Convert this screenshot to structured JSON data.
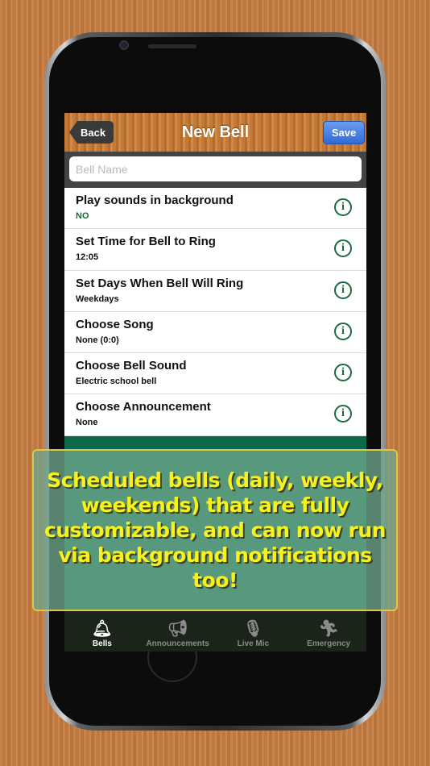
{
  "nav": {
    "back": "Back",
    "title": "New Bell",
    "save": "Save"
  },
  "bell_name": {
    "placeholder": "Bell Name",
    "value": ""
  },
  "rows": [
    {
      "title": "Play sounds in background",
      "value": "NO"
    },
    {
      "title": "Set Time for Bell to Ring",
      "value": "12:05"
    },
    {
      "title": "Set Days When Bell Will Ring",
      "value": "Weekdays"
    },
    {
      "title": "Choose Song",
      "value": "None (0:0)"
    },
    {
      "title": "Choose Bell Sound",
      "value": "Electric school bell"
    },
    {
      "title": "Choose Announcement",
      "value": "None"
    }
  ],
  "tabs": [
    {
      "label": "Bells",
      "icon": "bell-icon",
      "active": true
    },
    {
      "label": "Announcements",
      "icon": "megaphone-icon"
    },
    {
      "label": "Live Mic",
      "icon": "microphone-icon"
    },
    {
      "label": "Emergency",
      "icon": "exit-icon"
    }
  ],
  "banner": "Scheduled bells (daily, weekly, weekends) that are fully customizable, and can now run via background notifications too!",
  "colors": {
    "accent_green": "#1b6a40",
    "banner_text": "#f7f21c",
    "save_blue": "#2f6ad8"
  }
}
